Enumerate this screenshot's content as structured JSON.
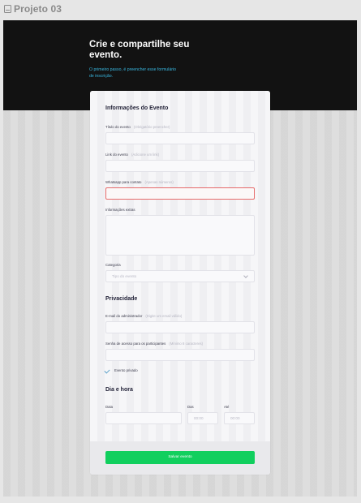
{
  "frame": {
    "title": "Projeto 03"
  },
  "hero": {
    "title": "Crie e compartilhe seu evento.",
    "subtitle": "O primeiro passo, é preencher esse formulário de inscrição."
  },
  "sections": {
    "event_info": "Informações do Evento",
    "privacy": "Privacidade",
    "date_time": "Dia e hora"
  },
  "fields": {
    "event_title": {
      "label": "Título do evento",
      "hint": "(Obrigatório preencher)"
    },
    "event_link": {
      "label": "Link do evento",
      "hint": "(Adicione um link)"
    },
    "whatsapp": {
      "label": "Whatsapp para contato",
      "hint": "(Apenas números)"
    },
    "extra_info": {
      "label": "Informações extras"
    },
    "category": {
      "label": "Categoria",
      "placeholder": "Tipo do evento"
    },
    "admin_email": {
      "label": "E-mail do administrador",
      "hint": "(Digite um email válido)"
    },
    "access_password": {
      "label": "Senha de acesso para os participantes",
      "hint": "(Mínimo 8 caracteres)"
    },
    "private_event": {
      "label": "Evento privado",
      "checked": true
    },
    "date": {
      "label": "Data"
    },
    "from": {
      "label": "Das",
      "placeholder": "00:00"
    },
    "to": {
      "label": "Até",
      "placeholder": "00:00"
    }
  },
  "footer": {
    "save_label": "Salvar evento"
  },
  "colors": {
    "hero_bg": "#121212",
    "accent_link": "#39b7e0",
    "error_border": "#e66a6a",
    "primary_button": "#11cf5e"
  },
  "icons": {
    "frame": "frame-icon",
    "chevron": "chevron-down-icon",
    "check": "check-icon"
  }
}
